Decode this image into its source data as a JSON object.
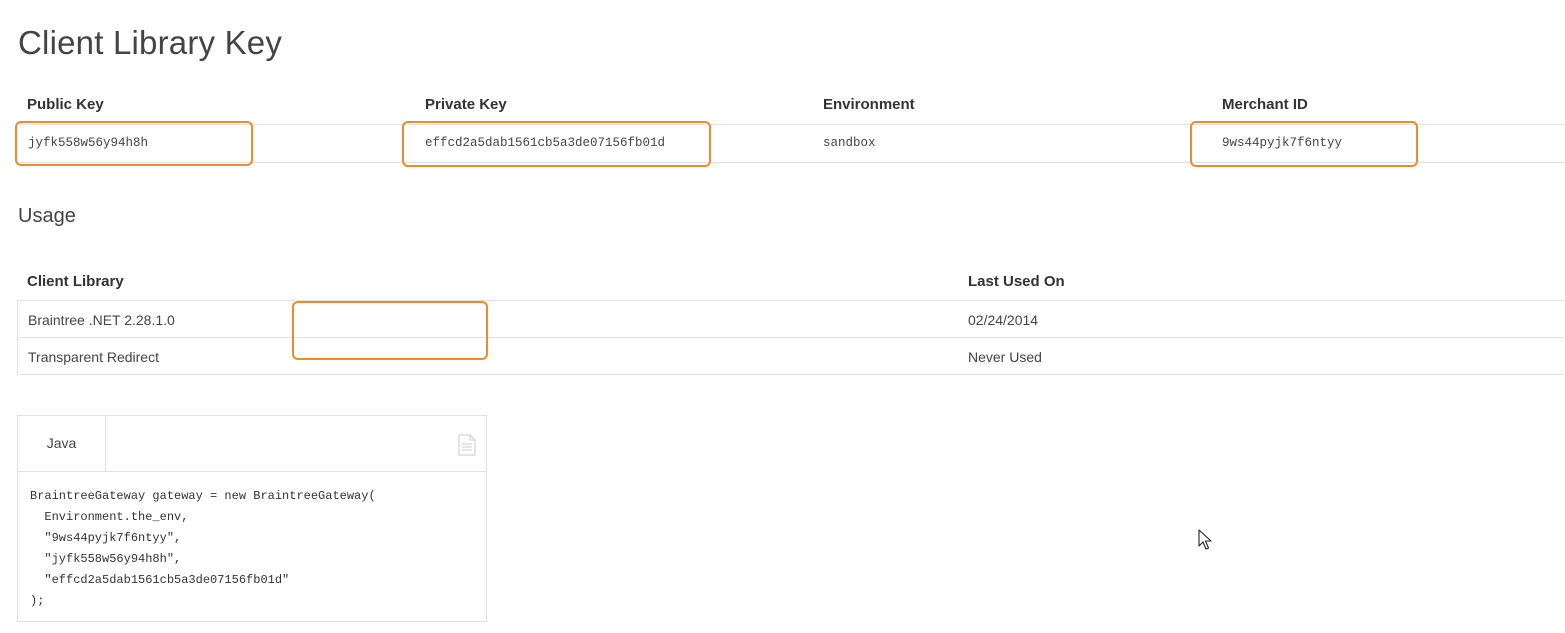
{
  "page": {
    "title": "Client Library Key"
  },
  "keys": {
    "headers": {
      "public_key": "Public Key",
      "private_key": "Private Key",
      "environment": "Environment",
      "merchant_id": "Merchant ID"
    },
    "values": {
      "public_key": "jyfk558w56y94h8h",
      "private_key": "effcd2a5dab1561cb5a3de07156fb01d",
      "environment": "sandbox",
      "merchant_id": "9ws44pyjk7f6ntyy"
    }
  },
  "usage": {
    "title": "Usage",
    "headers": {
      "client_library": "Client Library",
      "last_used_on": "Last Used On"
    },
    "rows": [
      {
        "library": "Braintree .NET 2.28.1.0",
        "last_used": "02/24/2014"
      },
      {
        "library": "Transparent Redirect",
        "last_used": "Never Used"
      }
    ]
  },
  "code_panel": {
    "tab_label": "Java",
    "copy_icon": "copy-document-icon",
    "lines": [
      "BraintreeGateway gateway = new BraintreeGateway(",
      "  Environment.the_env,",
      "  \"9ws44pyjk7f6ntyy\",",
      "  \"jyfk558w56y94h8h\",",
      "  \"effcd2a5dab1561cb5a3de07156fb01d\"",
      ");"
    ]
  },
  "colors": {
    "highlight": "#ee8a2f",
    "border": "#e2e2e2",
    "text": "#444444"
  }
}
